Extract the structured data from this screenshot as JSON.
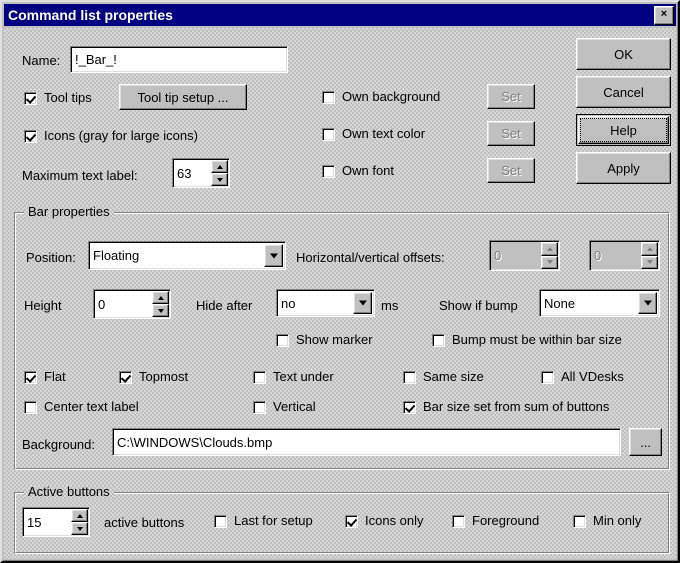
{
  "window": {
    "title": "Command list properties",
    "close_label": "×"
  },
  "colors": {
    "titlebar": "#000080",
    "face": "#c0c0c0",
    "disabled_text": "#808080"
  },
  "top_section": {
    "name_label": "Name:",
    "name_value": "!_Bar_!",
    "tool_tips_label": "Tool tips",
    "tool_tips_checked": true,
    "tool_tip_setup_button": "Tool tip setup ...",
    "icons_label": "Icons (gray for large icons)",
    "icons_checked": true,
    "max_text_label": "Maximum text label:",
    "max_text_value": "63",
    "own_background_label": "Own background",
    "own_background_checked": false,
    "own_text_color_label": "Own text color",
    "own_text_color_checked": false,
    "own_font_label": "Own font",
    "own_font_checked": false,
    "set_button": "Set"
  },
  "action_buttons": {
    "ok": "OK",
    "cancel": "Cancel",
    "help": "Help",
    "apply": "Apply"
  },
  "bar_properties": {
    "group_title": "Bar properties",
    "position_label": "Position:",
    "position_value": "Floating",
    "offsets_label": "Horizontal/vertical offsets:",
    "offset_h_value": "0",
    "offset_v_value": "0",
    "height_label": "Height",
    "height_value": "0",
    "hide_after_label": "Hide after",
    "hide_after_value": "no",
    "ms_label": "ms",
    "show_if_bump_label": "Show if bump",
    "show_if_bump_value": "None",
    "show_marker_label": "Show marker",
    "show_marker_checked": false,
    "bump_within_label": "Bump must be within bar size",
    "bump_within_checked": false,
    "flat_label": "Flat",
    "flat_checked": true,
    "topmost_label": "Topmost",
    "topmost_checked": true,
    "text_under_label": "Text under",
    "text_under_checked": false,
    "same_size_label": "Same size",
    "same_size_checked": false,
    "all_vdesks_label": "All VDesks",
    "all_vdesks_checked": false,
    "center_text_label": "Center text label",
    "center_text_checked": false,
    "vertical_label": "Vertical",
    "vertical_checked": false,
    "bar_size_sum_label": "Bar size set from sum of buttons",
    "bar_size_sum_checked": true,
    "background_label": "Background:",
    "background_value": "C:\\WINDOWS\\Clouds.bmp",
    "browse_button": "..."
  },
  "active_buttons": {
    "group_title": "Active buttons",
    "count_value": "15",
    "count_label": "active buttons",
    "last_for_setup_label": "Last for setup",
    "last_for_setup_checked": false,
    "icons_only_label": "Icons only",
    "icons_only_checked": true,
    "foreground_label": "Foreground",
    "foreground_checked": false,
    "min_only_label": "Min only",
    "min_only_checked": false
  }
}
